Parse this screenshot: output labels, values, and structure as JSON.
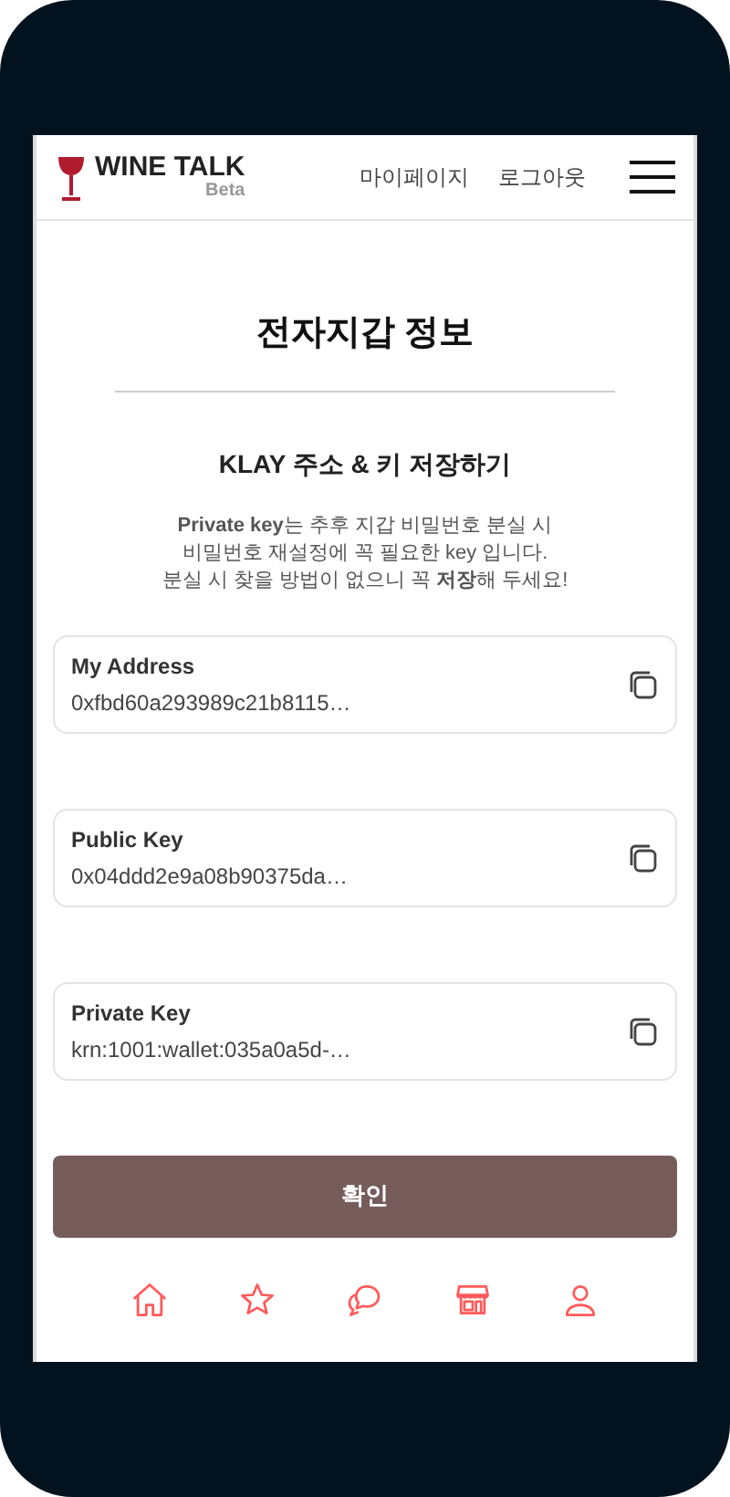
{
  "header": {
    "brand": "WINE TALK",
    "badge": "Beta",
    "links": [
      "마이페이지",
      "로그아웃"
    ]
  },
  "title": "전자지갑 정보",
  "subtitle": "KLAY 주소 & 키 저장하기",
  "notice": [
    "**Private key**는 추후 지갑 비밀번호 분실 시",
    "비밀번호 재설정에 꼭 필요한 key 입니다.",
    "분실 시 찾을 방법이 없으니 꼭 **저장**해 두세요!"
  ],
  "fields": [
    {
      "label": "My Address",
      "value": "0xfbd60a293989c21b8115…"
    },
    {
      "label": "Public Key",
      "value": "0x04ddd2e9a08b90375da…"
    },
    {
      "label": "Private Key",
      "value": "krn:1001:wallet:035a0a5d-…"
    }
  ],
  "confirm_button": "확인",
  "nav": [
    {
      "kind": "home"
    },
    {
      "kind": "star"
    },
    {
      "kind": "chat"
    },
    {
      "kind": "store"
    },
    {
      "kind": "user"
    }
  ]
}
